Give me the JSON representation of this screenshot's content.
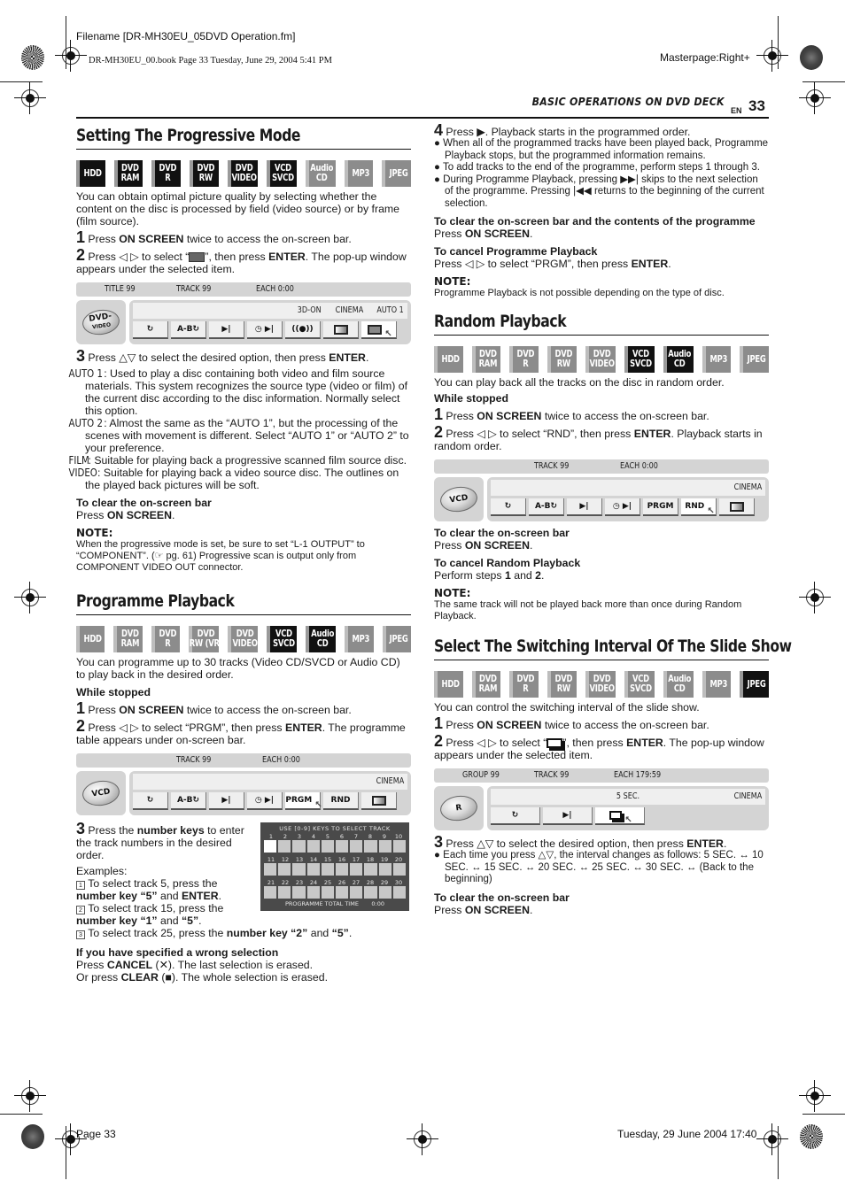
{
  "print_meta": {
    "filename": "Filename [DR-MH30EU_05DVD Operation.fm]",
    "book_info": "DR-MH30EU_00.book  Page 33  Tuesday, June 29, 2004  5:41 PM",
    "masterpage": "Masterpage:Right+",
    "footer_page": "Page 33",
    "footer_date": "Tuesday, 29 June 2004  17:40"
  },
  "header": {
    "running_head": "BASIC OPERATIONS ON DVD DECK",
    "lang": "EN",
    "page_number": "33"
  },
  "badge_labels": [
    "HDD",
    "DVD RAM",
    "DVD R",
    "DVD RW",
    "DVD VIDEO",
    "VCD SVCD",
    "Audio CD",
    "MP3",
    "JPEG"
  ],
  "progressive": {
    "title": "Setting The Progressive Mode",
    "badges": [
      {
        "l1": "HDD",
        "l2": "",
        "on": true
      },
      {
        "l1": "DVD",
        "l2": "RAM",
        "on": true
      },
      {
        "l1": "DVD",
        "l2": "R",
        "on": true
      },
      {
        "l1": "DVD",
        "l2": "RW",
        "on": true
      },
      {
        "l1": "DVD",
        "l2": "VIDEO",
        "on": true
      },
      {
        "l1": "VCD",
        "l2": "SVCD",
        "on": true
      },
      {
        "l1": "Audio",
        "l2": "CD",
        "on": false
      },
      {
        "l1": "MP3",
        "l2": "",
        "on": false
      },
      {
        "l1": "JPEG",
        "l2": "",
        "on": false
      }
    ],
    "intro": "You can obtain optimal picture quality by selecting whether the content on the disc is processed by field (video source) or by frame (film source).",
    "step1_num": "1",
    "step1_a": " Press ",
    "step1_b": "ON SCREEN",
    "step1_c": " twice to access the on-screen bar.",
    "step2_num": "2",
    "step2_a": " Press ◁ ▷ to select “",
    "step2_b": "”, then press ",
    "step2_c": "ENTER",
    "step2_d": ". The pop-up window appears under the selected item.",
    "osd": {
      "top": [
        "TITLE 99",
        "TRACK 99",
        "EACH 0:00"
      ],
      "disc_label": "DVD-",
      "disc_sub": "VIDEO",
      "status": [
        "3D-ON",
        "CINEMA",
        "AUTO 1"
      ],
      "buttons": [
        "↻",
        "A-B↻",
        "▶|",
        "◷ ▶|",
        "((●))",
        "",
        ""
      ]
    },
    "step3_num": "3",
    "step3_a": " Press △▽ to select the desired option, then press ",
    "step3_b": "ENTER",
    "step3_c": ".",
    "options": [
      {
        "key": "AUTO 1",
        "text": ": Used to play a disc containing both video and film source materials. This system recognizes the source type (video or film) of the current disc according to the disc information. Normally select this option."
      },
      {
        "key": "AUTO 2",
        "text": ": Almost the same as the “AUTO 1”, but the processing of the scenes with movement is different. Select “AUTO 1” or “AUTO 2” to your preference."
      },
      {
        "key": "FILM",
        "text": ": Suitable for playing back a progressive scanned film source disc."
      },
      {
        "key": "VIDEO",
        "text": ": Suitable for playing back a video source disc. The outlines on the played back pictures will be soft."
      }
    ],
    "clear_head": "To clear the on-screen bar",
    "clear_a": "Press ",
    "clear_b": "ON SCREEN",
    "clear_c": ".",
    "note_head": "NOTE:",
    "note": "When the progressive mode is set, be sure to set “L-1 OUTPUT” to “COMPONENT”. (☞ pg. 61) Progressive scan is output only from COMPONENT VIDEO OUT connector."
  },
  "programme": {
    "title": "Programme Playback",
    "badges": [
      {
        "l1": "HDD",
        "l2": "",
        "on": false
      },
      {
        "l1": "DVD",
        "l2": "RAM",
        "on": false
      },
      {
        "l1": "DVD",
        "l2": "R",
        "on": false
      },
      {
        "l1": "DVD",
        "l2": "RW (VR)",
        "on": false
      },
      {
        "l1": "DVD",
        "l2": "VIDEO",
        "on": false
      },
      {
        "l1": "VCD",
        "l2": "SVCD",
        "on": true
      },
      {
        "l1": "Audio",
        "l2": "CD",
        "on": true
      },
      {
        "l1": "MP3",
        "l2": "",
        "on": false
      },
      {
        "l1": "JPEG",
        "l2": "",
        "on": false
      }
    ],
    "intro": "You can programme up to 30 tracks (Video CD/SVCD or Audio CD) to play back in the desired order.",
    "while_stopped": "While stopped",
    "step1_num": "1",
    "step1_a": " Press ",
    "step1_b": "ON SCREEN",
    "step1_c": " twice to access the on-screen bar.",
    "step2_num": "2",
    "step2_a": " Press ◁ ▷ to select “PRGM”, then press ",
    "step2_b": "ENTER",
    "step2_c": ". The programme table appears under on-screen bar.",
    "osd": {
      "top": [
        "TRACK 99",
        "EACH 0:00"
      ],
      "disc_label": "VCD",
      "status": [
        "CINEMA"
      ],
      "buttons": [
        "↻",
        "A-B↻",
        "▶|",
        "◷ ▶|",
        "PRGM",
        "RND",
        ""
      ]
    },
    "step3_num": "3",
    "step3_a": " Press the ",
    "step3_b": "number keys",
    "step3_c": " to enter the track numbers in the desired order.",
    "examples_label": "Examples:",
    "ex1_n": "1",
    "ex1_a": " To select track 5, press the ",
    "ex1_b": "number key “5”",
    "ex1_c": " and ",
    "ex1_d": "ENTER",
    "ex1_e": ".",
    "ex2_n": "2",
    "ex2_a": " To select track 15, press the ",
    "ex2_b": "number key “1”",
    "ex2_c": " and ",
    "ex2_d": "“5”",
    "ex2_e": ".",
    "ex3_n": "3",
    "ex3_a": " To select track 25, press the ",
    "ex3_b": "number key “2”",
    "ex3_c": " and ",
    "ex3_d": "“5”",
    "ex3_e": ".",
    "table": {
      "title": "USE [0-9] KEYS TO SELECT TRACK",
      "rows": [
        [
          "1",
          "2",
          "3",
          "4",
          "5",
          "6",
          "7",
          "8",
          "9",
          "10"
        ],
        [
          "11",
          "12",
          "13",
          "14",
          "15",
          "16",
          "17",
          "18",
          "19",
          "20"
        ],
        [
          "21",
          "22",
          "23",
          "24",
          "25",
          "26",
          "27",
          "28",
          "29",
          "30"
        ]
      ],
      "total_label": "PROGRAMME TOTAL TIME",
      "total_value": "0:00"
    },
    "wrong_head": "If you have specified a wrong selection",
    "wrong1_a": "Press ",
    "wrong1_b": "CANCEL",
    "wrong1_c": " (✕). The last selection is erased.",
    "wrong2_a": "Or press ",
    "wrong2_b": "CLEAR",
    "wrong2_c": " (■). The whole selection is erased.",
    "step4_num": "4",
    "step4_a": " Press ▶. Playback starts in the programmed order.",
    "bullets": [
      "When all of the programmed tracks have been played back, Programme Playback stops, but the programmed information remains.",
      "To add tracks to the end of the programme, perform steps 1 through 3.",
      "During Programme Playback, pressing ▶▶| skips to the next selection of the programme. Pressing |◀◀ returns to the beginning of the current selection."
    ],
    "clear_head": "To clear the on-screen bar and the contents of the programme",
    "clear_a": "Press ",
    "clear_b": "ON SCREEN",
    "clear_c": ".",
    "cancel_head": "To cancel Programme Playback",
    "cancel_a": "Press ◁ ▷ to select “PRGM”, then press ",
    "cancel_b": "ENTER",
    "cancel_c": ".",
    "note_head": "NOTE:",
    "note": "Programme Playback is not possible depending on the type of disc."
  },
  "random": {
    "title": "Random Playback",
    "badges": [
      {
        "l1": "HDD",
        "l2": "",
        "on": false
      },
      {
        "l1": "DVD",
        "l2": "RAM",
        "on": false
      },
      {
        "l1": "DVD",
        "l2": "R",
        "on": false
      },
      {
        "l1": "DVD",
        "l2": "RW",
        "on": false
      },
      {
        "l1": "DVD",
        "l2": "VIDEO",
        "on": false
      },
      {
        "l1": "VCD",
        "l2": "SVCD",
        "on": true
      },
      {
        "l1": "Audio",
        "l2": "CD",
        "on": true
      },
      {
        "l1": "MP3",
        "l2": "",
        "on": false
      },
      {
        "l1": "JPEG",
        "l2": "",
        "on": false
      }
    ],
    "intro": "You can play back all the tracks on the disc in random order.",
    "while_stopped": "While stopped",
    "step1_num": "1",
    "step1_a": " Press ",
    "step1_b": "ON SCREEN",
    "step1_c": " twice to access the on-screen bar.",
    "step2_num": "2",
    "step2_a": " Press ◁ ▷ to select “RND”, then press ",
    "step2_b": "ENTER",
    "step2_c": ". Playback starts in random order.",
    "osd": {
      "top": [
        "TRACK 99",
        "EACH 0:00"
      ],
      "disc_label": "VCD",
      "status": [
        "CINEMA"
      ],
      "buttons": [
        "↻",
        "A-B↻",
        "▶|",
        "◷ ▶|",
        "PRGM",
        "RND",
        ""
      ]
    },
    "clear_head": "To clear the on-screen bar",
    "clear_a": "Press ",
    "clear_b": "ON SCREEN",
    "clear_c": ".",
    "cancel_head": "To cancel Random Playback",
    "cancel_a": "Perform steps ",
    "cancel_b": "1",
    "cancel_c": " and ",
    "cancel_d": "2",
    "cancel_e": ".",
    "note_head": "NOTE:",
    "note": "The same track will not be played back more than once during Random Playback."
  },
  "slideshow": {
    "title": "Select The Switching Interval Of The Slide Show",
    "badges": [
      {
        "l1": "HDD",
        "l2": "",
        "on": false
      },
      {
        "l1": "DVD",
        "l2": "RAM",
        "on": false
      },
      {
        "l1": "DVD",
        "l2": "R",
        "on": false
      },
      {
        "l1": "DVD",
        "l2": "RW",
        "on": false
      },
      {
        "l1": "DVD",
        "l2": "VIDEO",
        "on": false
      },
      {
        "l1": "VCD",
        "l2": "SVCD",
        "on": false
      },
      {
        "l1": "Audio",
        "l2": "CD",
        "on": false
      },
      {
        "l1": "MP3",
        "l2": "",
        "on": false
      },
      {
        "l1": "JPEG",
        "l2": "",
        "on": true
      }
    ],
    "intro": "You can control the switching interval of the slide show.",
    "step1_num": "1",
    "step1_a": " Press ",
    "step1_b": "ON SCREEN",
    "step1_c": " twice to access the on-screen bar.",
    "step2_num": "2",
    "step2_a": " Press ◁ ▷ to select “",
    "step2_b": "”, then press ",
    "step2_c": "ENTER",
    "step2_d": ". The pop-up window appears under the selected item.",
    "osd": {
      "top": [
        "GROUP 99",
        "TRACK 99",
        "EACH 179:59"
      ],
      "disc_label": "R",
      "status_center": "5 SEC.",
      "status": [
        "CINEMA"
      ],
      "buttons": [
        "↻",
        "▶|",
        ""
      ]
    },
    "step3_num": "3",
    "step3_a": " Press △▽ to select the desired option, then press ",
    "step3_b": "ENTER",
    "step3_c": ".",
    "bullet": "Each time you press △▽, the interval changes as follows: 5 SEC. ↔ 10 SEC. ↔ 15 SEC. ↔ 20 SEC. ↔ 25 SEC. ↔ 30 SEC. ↔ (Back to the beginning)",
    "intervals": [
      "5 SEC.",
      "10 SEC.",
      "15 SEC.",
      "20 SEC.",
      "25 SEC.",
      "30 SEC."
    ],
    "clear_head": "To clear the on-screen bar",
    "clear_a": "Press ",
    "clear_b": "ON SCREEN",
    "clear_c": "."
  }
}
